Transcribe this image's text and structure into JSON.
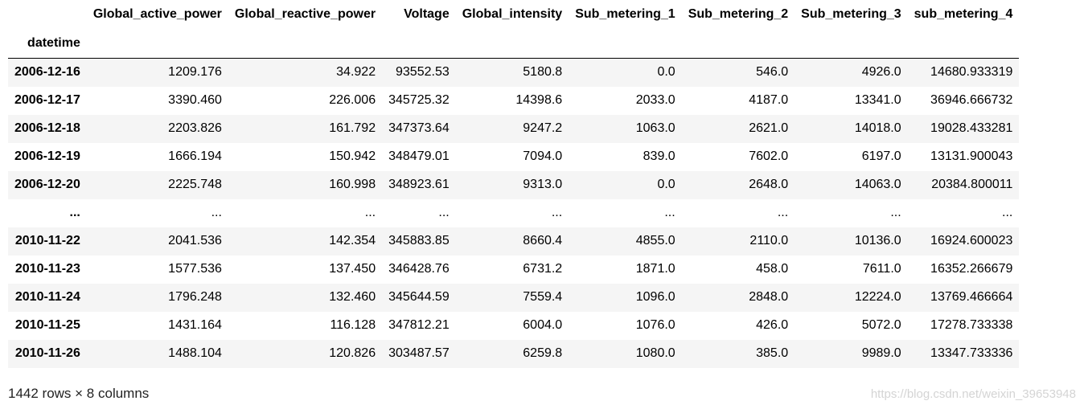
{
  "table": {
    "columns": [
      "Global_active_power",
      "Global_reactive_power",
      "Voltage",
      "Global_intensity",
      "Sub_metering_1",
      "Sub_metering_2",
      "Sub_metering_3",
      "sub_metering_4"
    ],
    "index_name": "datetime",
    "rows": [
      {
        "index": "2006-12-16",
        "values": [
          "1209.176",
          "34.922",
          "93552.53",
          "5180.8",
          "0.0",
          "546.0",
          "4926.0",
          "14680.933319"
        ]
      },
      {
        "index": "2006-12-17",
        "values": [
          "3390.460",
          "226.006",
          "345725.32",
          "14398.6",
          "2033.0",
          "4187.0",
          "13341.0",
          "36946.666732"
        ]
      },
      {
        "index": "2006-12-18",
        "values": [
          "2203.826",
          "161.792",
          "347373.64",
          "9247.2",
          "1063.0",
          "2621.0",
          "14018.0",
          "19028.433281"
        ]
      },
      {
        "index": "2006-12-19",
        "values": [
          "1666.194",
          "150.942",
          "348479.01",
          "7094.0",
          "839.0",
          "7602.0",
          "6197.0",
          "13131.900043"
        ]
      },
      {
        "index": "2006-12-20",
        "values": [
          "2225.748",
          "160.998",
          "348923.61",
          "9313.0",
          "0.0",
          "2648.0",
          "14063.0",
          "20384.800011"
        ]
      },
      {
        "index": "...",
        "values": [
          "...",
          "...",
          "...",
          "...",
          "...",
          "...",
          "...",
          "..."
        ]
      },
      {
        "index": "2010-11-22",
        "values": [
          "2041.536",
          "142.354",
          "345883.85",
          "8660.4",
          "4855.0",
          "2110.0",
          "10136.0",
          "16924.600023"
        ]
      },
      {
        "index": "2010-11-23",
        "values": [
          "1577.536",
          "137.450",
          "346428.76",
          "6731.2",
          "1871.0",
          "458.0",
          "7611.0",
          "16352.266679"
        ]
      },
      {
        "index": "2010-11-24",
        "values": [
          "1796.248",
          "132.460",
          "345644.59",
          "7559.4",
          "1096.0",
          "2848.0",
          "12224.0",
          "13769.466664"
        ]
      },
      {
        "index": "2010-11-25",
        "values": [
          "1431.164",
          "116.128",
          "347812.21",
          "6004.0",
          "1076.0",
          "426.0",
          "5072.0",
          "17278.733338"
        ]
      },
      {
        "index": "2010-11-26",
        "values": [
          "1488.104",
          "120.826",
          "303487.57",
          "6259.8",
          "1080.0",
          "385.0",
          "9989.0",
          "13347.733336"
        ]
      }
    ]
  },
  "shape_text": "1442 rows × 8 columns",
  "watermark": "https://blog.csdn.net/weixin_39653948"
}
